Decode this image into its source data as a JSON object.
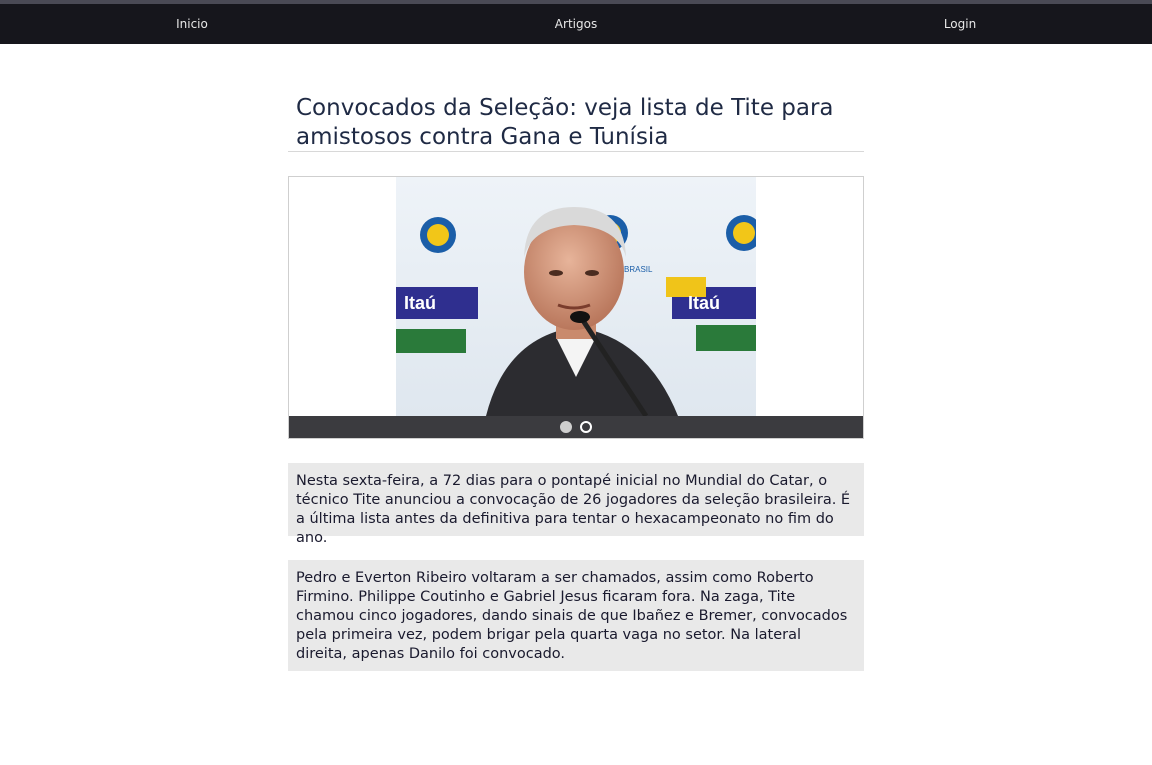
{
  "nav": {
    "items": [
      {
        "label": "Inicio"
      },
      {
        "label": "Artigos"
      },
      {
        "label": "Login"
      }
    ]
  },
  "article": {
    "title": "Convocados da Seleção: veja lista de Tite para amistosos contra Gana e Tunísia",
    "paragraphs": [
      "Nesta sexta-feira, a 72 dias para o pontapé inicial no Mundial do Catar, o técnico Tite anunciou a convocação de 26 jogadores da seleção brasileira. É a última lista antes da definitiva para tentar o hexacampeonato no fim do ano.",
      "Pedro e Everton Ribeiro voltaram a ser chamados, assim como Roberto Firmino. Philippe Coutinho e Gabriel Jesus ficaram fora. Na zaga, Tite chamou cinco jogadores, dando sinais de que Ibañez e Bremer, convocados pela primeira vez, podem brigar pela quarta vaga no setor. Na lateral direita, apenas Danilo foi convocado."
    ]
  },
  "carousel": {
    "slide_count": 2,
    "active_index": 0,
    "backdrop_text": [
      "Itaú",
      "Itaú",
      "Itaú",
      "BRASIL",
      "BRASIL"
    ]
  },
  "colors": {
    "nav_bg": "#16161c",
    "paragraph_bg": "#e9e9e9",
    "title_color": "#1f2a44",
    "carousel_bar": "#3b3b3f"
  }
}
